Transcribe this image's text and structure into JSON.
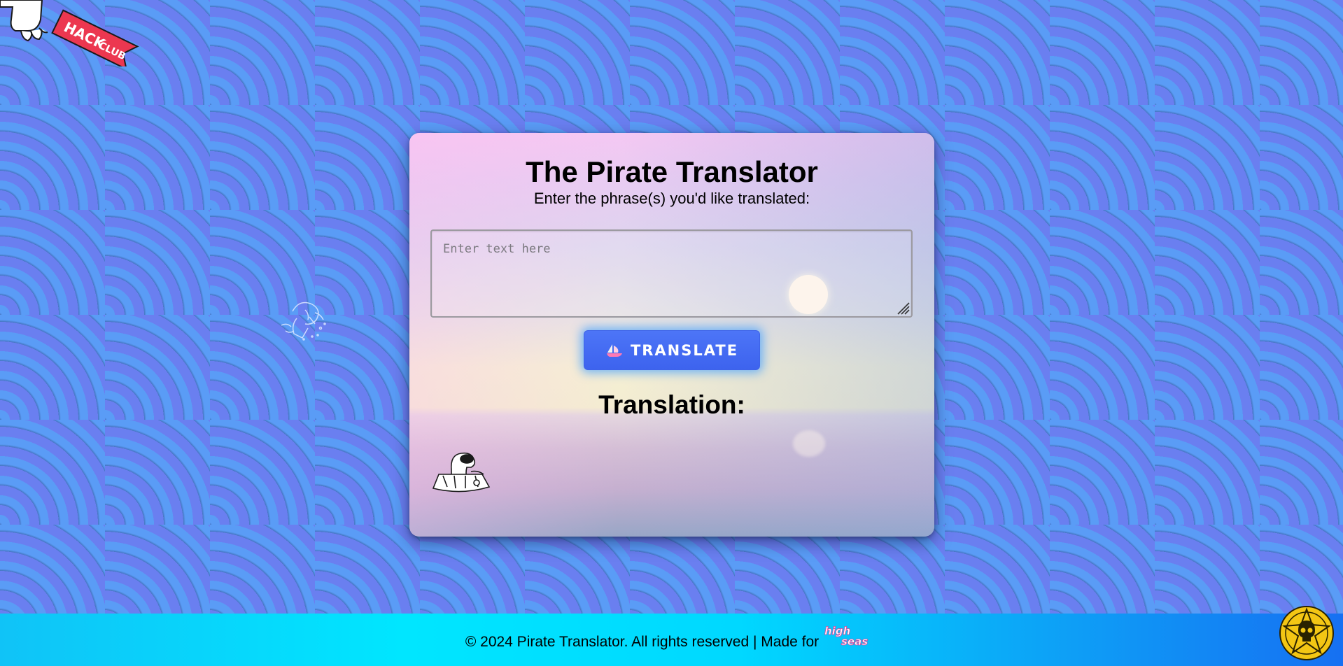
{
  "app": {
    "title": "The Pirate Translator",
    "subtitle": "Enter the phrase(s) you'd like translated:"
  },
  "input": {
    "placeholder": "Enter text here",
    "value": ""
  },
  "actions": {
    "translate_label": "TRANSLATE",
    "translate_icon": "ship-icon"
  },
  "output": {
    "label": "Translation:",
    "text": ""
  },
  "branding": {
    "hackclub_flag_text": "HACK CLUB",
    "highseas_logo_text": "high seas"
  },
  "footer": {
    "text": "© 2024 Pirate Translator. All rights reserved | Made for"
  },
  "colors": {
    "button": "#4169f0",
    "button_glow": "#46a0ff",
    "background_stripe_light": "#5a9cf6",
    "background_stripe_dark": "#6a7ff0",
    "footer_cyan": "#00e6ff",
    "footer_blue": "#1670f2",
    "flag_red": "#ec3750"
  }
}
